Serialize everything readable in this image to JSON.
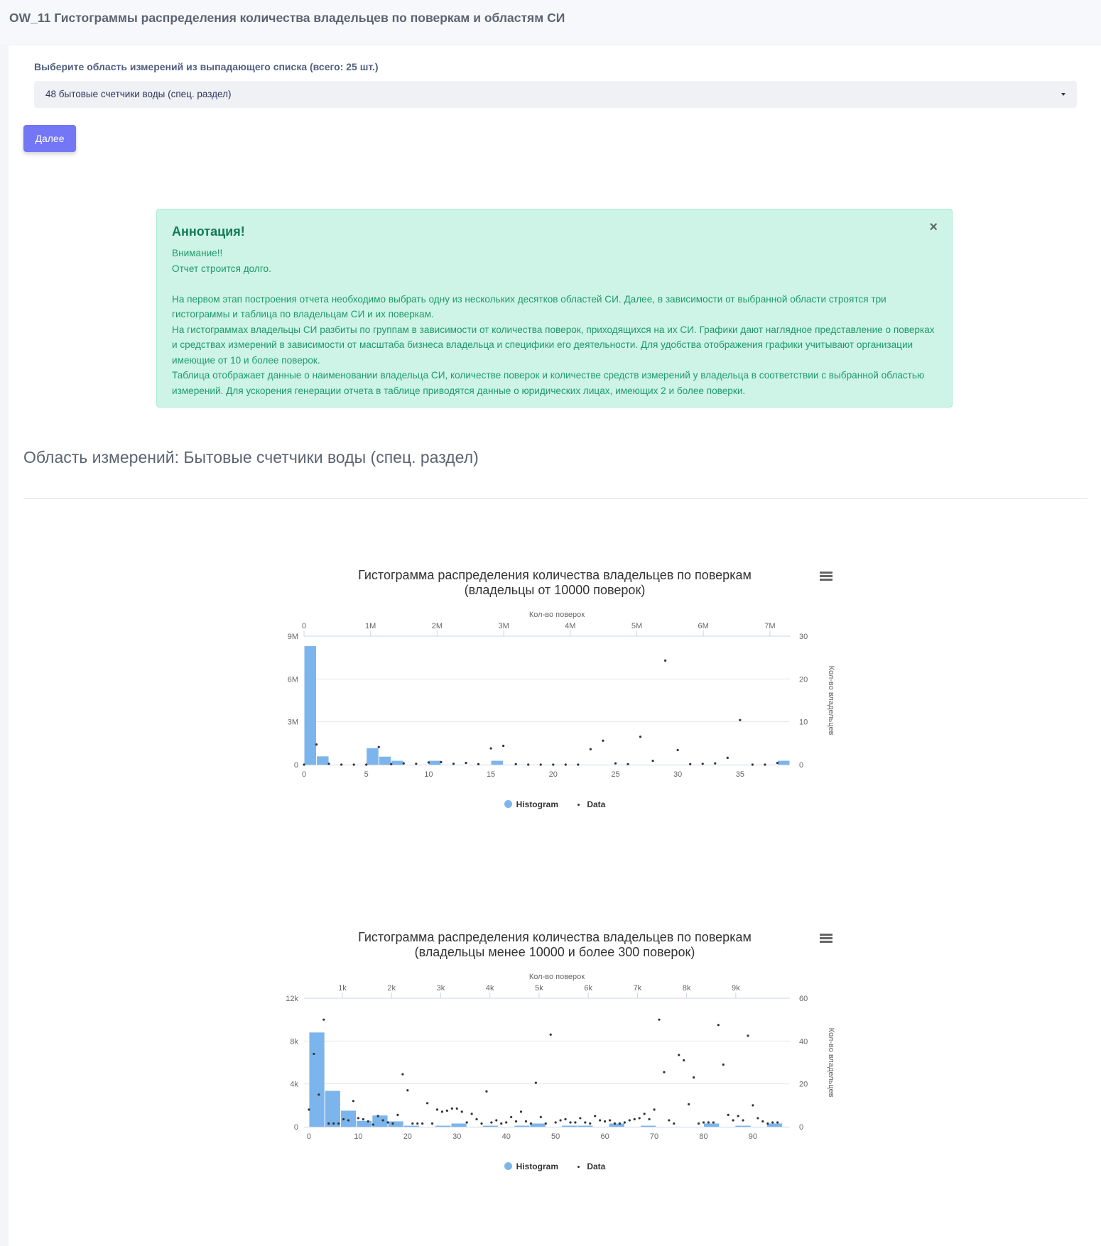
{
  "page_title": "OW_11 Гистограммы распределения количества владельцев по поверкам и областям СИ",
  "select": {
    "label": "Выберите область измерений из выпадающего списка (всего: 25 шт.)",
    "value": "48 бытовые счетчики воды (спец. раздел)"
  },
  "next_button": "Далее",
  "alert": {
    "title": "Аннотация!",
    "close": "×",
    "line1": "Внимание!!",
    "line2": "Отчет строится долго.",
    "para1": "На первом этап построения отчета необходимо выбрать одну из нескольких десятков областей СИ. Далее, в зависимости от выбранной области строятся три гистограммы и таблица по владельцам СИ и их поверкам.",
    "para2": "На гистограммах владельцы СИ разбиты по группам в зависимости от количества поверок, приходящихся на их СИ. Графики дают наглядное представление о поверках и средствах измерений в зависимости от масштаба бизнеса владельца и специфики его деятельности. Для удобства отображения графики учитывают организации имеющие от 10 и более поверок.",
    "para3": "Таблица отображает данные о наименовании владельца СИ, количестве поверок и количестве средств измерений у владельца в соответствии с выбранной областью измерений. Для ускорения генерации отчета в таблице приводятся данные о юридических лицах, имеющих 2 и более поверки."
  },
  "section_title": "Область измерений: Бытовые счетчики воды (спец. раздел)",
  "colors": {
    "histogram": "#7cb5ec",
    "data": "#333333",
    "button": "#7377f5"
  },
  "chart_data": [
    {
      "type": "bar",
      "title_line1": "Гистограмма распределения количества владельцев по поверкам",
      "title_line2": "(владельцы от 10000 поверок)",
      "top_axis_title": "Кол-во поверок",
      "top_axis_ticks": [
        "0",
        "1M",
        "2M",
        "3M",
        "4M",
        "5M",
        "6M",
        "7M"
      ],
      "top_axis_values": [
        0,
        1000000,
        2000000,
        3000000,
        4000000,
        5000000,
        6000000,
        7000000
      ],
      "top_axis_range": [
        0,
        7300000
      ],
      "left_axis_ticks": [
        "0",
        "3M",
        "6M",
        "9M"
      ],
      "left_axis_values": [
        0,
        3000000,
        6000000,
        9000000
      ],
      "left_axis_range": [
        0,
        9000000
      ],
      "right_axis_title": "Кол-во владельцев",
      "right_axis_ticks": [
        "0",
        "10",
        "20",
        "30"
      ],
      "right_axis_values": [
        0,
        10,
        20,
        30
      ],
      "right_axis_range": [
        0,
        30
      ],
      "bottom_axis_ticks": [
        "0",
        "5",
        "10",
        "15",
        "20",
        "25",
        "30",
        "35"
      ],
      "bottom_axis_values": [
        0,
        5,
        10,
        15,
        20,
        25,
        30,
        35
      ],
      "bottom_axis_range": [
        0,
        39
      ],
      "histogram": {
        "name": "Histogram",
        "bins": [
          {
            "start": 0,
            "end": 1,
            "value": 8300000
          },
          {
            "start": 1,
            "end": 2,
            "value": 580000
          },
          {
            "start": 5,
            "end": 6,
            "value": 1150000
          },
          {
            "start": 6,
            "end": 7,
            "value": 560000
          },
          {
            "start": 7,
            "end": 8,
            "value": 270000
          },
          {
            "start": 10,
            "end": 11,
            "value": 270000
          },
          {
            "start": 15,
            "end": 16,
            "value": 270000
          },
          {
            "start": 38,
            "end": 39,
            "value": 270000
          }
        ]
      },
      "scatter": {
        "name": "Data",
        "points": [
          [
            0,
            0
          ],
          [
            1,
            4.7
          ],
          [
            2,
            0.2
          ],
          [
            3,
            0
          ],
          [
            4,
            0
          ],
          [
            5,
            0
          ],
          [
            6,
            4.1
          ],
          [
            7,
            0.1
          ],
          [
            8,
            0.3
          ],
          [
            9,
            0.2
          ],
          [
            10,
            0.5
          ],
          [
            11,
            0.6
          ],
          [
            12,
            0.2
          ],
          [
            13,
            0.4
          ],
          [
            14,
            0.1
          ],
          [
            15,
            3.8
          ],
          [
            16,
            4.4
          ],
          [
            17,
            0.1
          ],
          [
            18,
            0
          ],
          [
            19,
            0
          ],
          [
            20,
            0
          ],
          [
            21,
            0
          ],
          [
            22,
            0
          ],
          [
            23,
            3.6
          ],
          [
            24,
            5.6
          ],
          [
            25,
            0.3
          ],
          [
            26,
            0.1
          ],
          [
            27,
            6.5
          ],
          [
            28,
            0.9
          ],
          [
            29,
            24.3
          ],
          [
            30,
            3.4
          ],
          [
            31,
            0.1
          ],
          [
            32,
            0.2
          ],
          [
            33,
            0.3
          ],
          [
            34,
            1.6
          ],
          [
            35,
            10.4
          ],
          [
            36,
            0
          ],
          [
            37,
            0
          ],
          [
            38,
            0.4
          ]
        ]
      },
      "legend": [
        "Histogram",
        "Data"
      ]
    },
    {
      "type": "bar",
      "title_line1": "Гистограмма распределения количества владельцев по поверкам",
      "title_line2": "(владельцы менее 10000 и более 300 поверок)",
      "top_axis_title": "Кол-во поверок",
      "top_axis_ticks": [
        "1k",
        "2k",
        "3k",
        "4k",
        "5k",
        "6k",
        "7k",
        "8k",
        "9k"
      ],
      "top_axis_values": [
        1000,
        2000,
        3000,
        4000,
        5000,
        6000,
        7000,
        8000,
        9000
      ],
      "top_axis_range": [
        220,
        10100
      ],
      "left_axis_ticks": [
        "0",
        "4k",
        "8k",
        "12k"
      ],
      "left_axis_values": [
        0,
        4000,
        8000,
        12000
      ],
      "left_axis_range": [
        0,
        12000
      ],
      "right_axis_title": "Кол-во владельцев",
      "right_axis_ticks": [
        "0",
        "20",
        "40",
        "60"
      ],
      "right_axis_values": [
        0,
        20,
        40,
        60
      ],
      "right_axis_range": [
        0,
        60
      ],
      "bottom_axis_ticks": [
        "0",
        "10",
        "20",
        "30",
        "40",
        "50",
        "60",
        "70",
        "80",
        "90"
      ],
      "bottom_axis_values": [
        0,
        10,
        20,
        30,
        40,
        50,
        60,
        70,
        80,
        90
      ],
      "bottom_axis_range": [
        -1,
        97.5
      ],
      "histogram": {
        "name": "Histogram",
        "bins": [
          {
            "start": 0,
            "end": 3.2,
            "value": 8800
          },
          {
            "start": 3.2,
            "end": 6.4,
            "value": 3350
          },
          {
            "start": 6.4,
            "end": 9.6,
            "value": 1500
          },
          {
            "start": 9.6,
            "end": 12.8,
            "value": 550
          },
          {
            "start": 12.8,
            "end": 16,
            "value": 1050
          },
          {
            "start": 16,
            "end": 19.2,
            "value": 500
          },
          {
            "start": 19.2,
            "end": 22.4,
            "value": 100
          },
          {
            "start": 25.6,
            "end": 28.8,
            "value": 100
          },
          {
            "start": 28.8,
            "end": 32,
            "value": 300
          },
          {
            "start": 35.2,
            "end": 38.4,
            "value": 100
          },
          {
            "start": 41.6,
            "end": 44.8,
            "value": 100
          },
          {
            "start": 44.8,
            "end": 48,
            "value": 300
          },
          {
            "start": 51.2,
            "end": 54.4,
            "value": 100
          },
          {
            "start": 54.4,
            "end": 57.6,
            "value": 100
          },
          {
            "start": 60.8,
            "end": 64,
            "value": 300
          },
          {
            "start": 67.2,
            "end": 70.4,
            "value": 100
          },
          {
            "start": 80,
            "end": 83.2,
            "value": 300
          },
          {
            "start": 86.4,
            "end": 89.6,
            "value": 100
          },
          {
            "start": 92.8,
            "end": 96,
            "value": 300
          }
        ]
      },
      "scatter": {
        "name": "Data",
        "points": [
          [
            0,
            8
          ],
          [
            1,
            34
          ],
          [
            2,
            15
          ],
          [
            3,
            50
          ],
          [
            4,
            1.5
          ],
          [
            5,
            1.5
          ],
          [
            6,
            1.5
          ],
          [
            7,
            3.5
          ],
          [
            8,
            3
          ],
          [
            9,
            12
          ],
          [
            10,
            4
          ],
          [
            11,
            3.5
          ],
          [
            12,
            2.5
          ],
          [
            13,
            1
          ],
          [
            14,
            5
          ],
          [
            15,
            3
          ],
          [
            16,
            2
          ],
          [
            17,
            1.5
          ],
          [
            18,
            5.5
          ],
          [
            19,
            24.5
          ],
          [
            20,
            17
          ],
          [
            21,
            1.5
          ],
          [
            22,
            1.5
          ],
          [
            23,
            1.5
          ],
          [
            24,
            11
          ],
          [
            25,
            1.5
          ],
          [
            26,
            8
          ],
          [
            27,
            7
          ],
          [
            28,
            7.5
          ],
          [
            29,
            8.5
          ],
          [
            30,
            8.5
          ],
          [
            31,
            7
          ],
          [
            32,
            2
          ],
          [
            33,
            6
          ],
          [
            34,
            3.5
          ],
          [
            35,
            1.5
          ],
          [
            36,
            16.5
          ],
          [
            37,
            2
          ],
          [
            38,
            3
          ],
          [
            39,
            1.5
          ],
          [
            40,
            2
          ],
          [
            41,
            4.5
          ],
          [
            42,
            2.5
          ],
          [
            43,
            7
          ],
          [
            44,
            2.5
          ],
          [
            45,
            1.5
          ],
          [
            46,
            20.5
          ],
          [
            47,
            4.5
          ],
          [
            48,
            1.5
          ],
          [
            49,
            43
          ],
          [
            50,
            2
          ],
          [
            51,
            3
          ],
          [
            52,
            3.5
          ],
          [
            53,
            2
          ],
          [
            54,
            2
          ],
          [
            55,
            4
          ],
          [
            56,
            2
          ],
          [
            57,
            1.5
          ],
          [
            58,
            5
          ],
          [
            59,
            3
          ],
          [
            60,
            2.5
          ],
          [
            61,
            3
          ],
          [
            62,
            1.5
          ],
          [
            63,
            1.5
          ],
          [
            64,
            2
          ],
          [
            65,
            3
          ],
          [
            66,
            3.5
          ],
          [
            67,
            4
          ],
          [
            68,
            6
          ],
          [
            69,
            3.5
          ],
          [
            70,
            8
          ],
          [
            71,
            50
          ],
          [
            72,
            25.5
          ],
          [
            73,
            3
          ],
          [
            74,
            1.5
          ],
          [
            75,
            33.5
          ],
          [
            76,
            31
          ],
          [
            77,
            10.5
          ],
          [
            78,
            23
          ],
          [
            79,
            1.5
          ],
          [
            80,
            2
          ],
          [
            81,
            2
          ],
          [
            82,
            2
          ],
          [
            83,
            47.5
          ],
          [
            84,
            29
          ],
          [
            85,
            5.5
          ],
          [
            86,
            3
          ],
          [
            87,
            5
          ],
          [
            88,
            3
          ],
          [
            89,
            42.5
          ],
          [
            90,
            10
          ],
          [
            91,
            4
          ],
          [
            92,
            2.5
          ],
          [
            93,
            1.5
          ],
          [
            94,
            2
          ],
          [
            95,
            2
          ]
        ]
      },
      "legend": [
        "Histogram",
        "Data"
      ]
    }
  ]
}
